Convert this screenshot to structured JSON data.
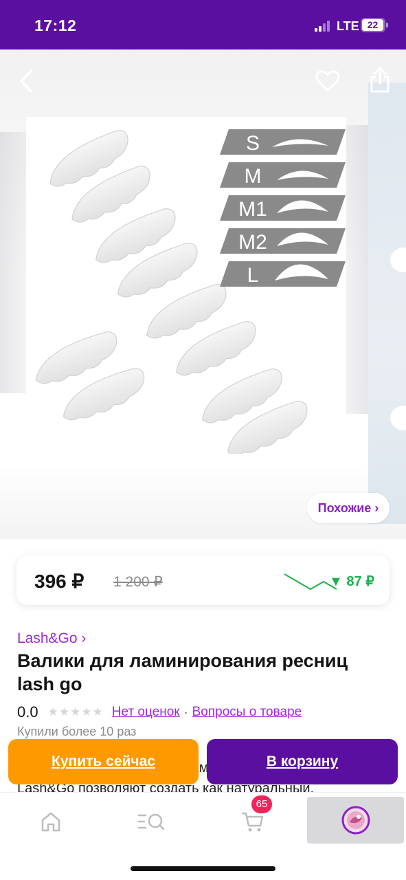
{
  "status_bar": {
    "time": "17:12",
    "network": "LTE",
    "battery_level": "22"
  },
  "gallery": {
    "back_icon": "chevron-left-icon",
    "favorite_icon": "heart-icon",
    "share_icon": "share-icon",
    "similar_label": "Похожие ›",
    "size_labels": [
      "S",
      "M",
      "M1",
      "M2",
      "L"
    ]
  },
  "price": {
    "current": "396 ₽",
    "old": "1 200 ₽",
    "drop": "▼ 87 ₽",
    "drop_color": "#19b34a",
    "trend_values": [
      3,
      2,
      1,
      2,
      1
    ]
  },
  "product": {
    "brand": "Lash&Go ›",
    "title": "Валики для ламинирования ресниц lash go",
    "rating": "0.0",
    "stars": "★★★★★",
    "no_reviews": "Нет оценок",
    "separator": "·",
    "questions": "Вопросы о товаре",
    "bought": "Купили более 10 раз",
    "description": "Силиконовые валики для ламинирования от\nLash&Go позволяют создать как натуральный,"
  },
  "actions": {
    "buy_now": "Купить сейчас",
    "add_to_cart": "В корзину"
  },
  "tab_bar": {
    "cart_count": "65",
    "icons": [
      "home-icon",
      "catalog-search-icon",
      "cart-icon",
      "profile-avatar-icon"
    ]
  },
  "colors": {
    "brand_purple": "#5a0fa0",
    "accent_orange": "#ff9900",
    "link_purple": "#9b2ad6",
    "badge_pink": "#f0245a"
  }
}
